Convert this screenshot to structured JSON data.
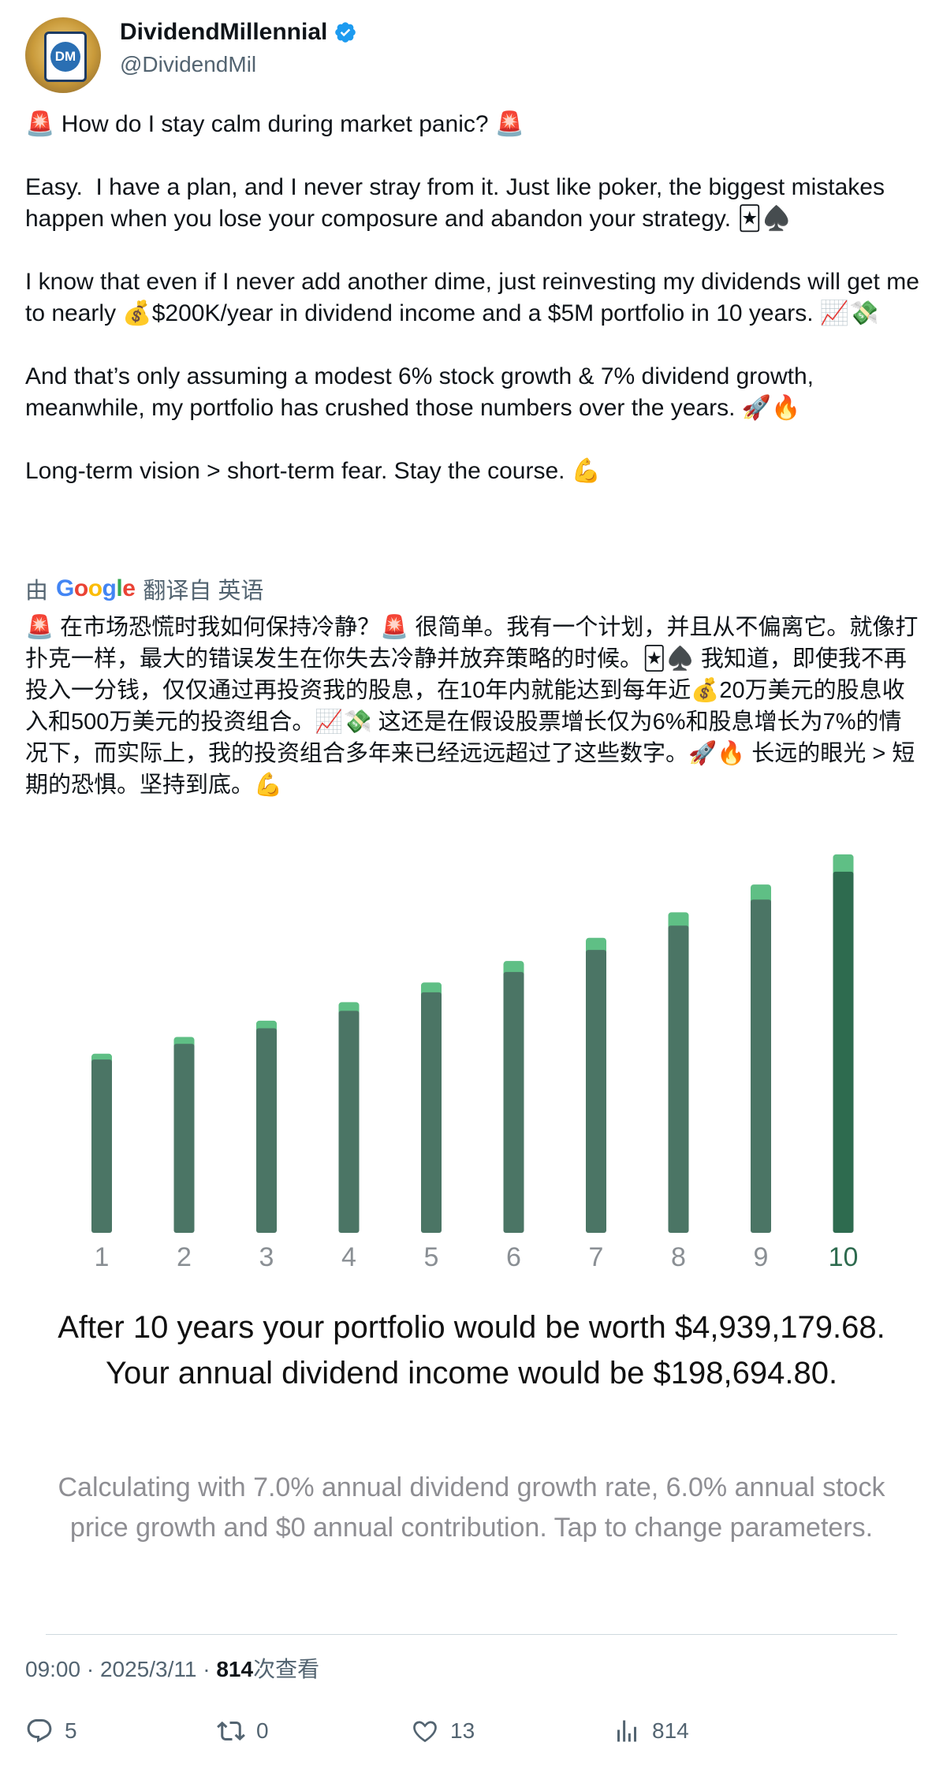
{
  "author": {
    "display_name": "DividendMillennial",
    "handle": "@DividendMil",
    "avatar_text": "DM",
    "verified": true
  },
  "tweet": {
    "paragraphs": [
      "🚨 How do I stay calm during market panic? 🚨",
      "Easy.  I have a plan, and I never stray from it. Just like poker, the biggest mistakes happen when you lose your composure and abandon your strategy. 🃏♠️",
      "I know that even if I never add another dime, just reinvesting my dividends will get me to nearly 💰$200K/year in dividend income and a $5M portfolio in 10 years. 📈💸",
      "And that’s only assuming a modest 6% stock growth & 7% dividend growth, meanwhile, my portfolio has crushed those numbers over the years. 🚀🔥",
      "Long-term vision > short-term fear. Stay the course. 💪"
    ]
  },
  "translation": {
    "prefix": "由",
    "google": "Google",
    "suffix": "翻译自 英语",
    "text": "🚨 在市场恐慌时我如何保持冷静？🚨 很简单。我有一个计划，并且从不偏离它。就像打扑克一样，最大的错误发生在你失去冷静并放弃策略的时候。🃏♠️ 我知道，即使我不再投入一分钱，仅仅通过再投资我的股息，在10年内就能达到每年近💰20万美元的股息收入和500万美元的投资组合。📈💸 这还是在假设股票增长仅为6%和股息增长为7%的情况下，而实际上，我的投资组合多年来已经远远超过了这些数字。🚀🔥 长远的眼光 > 短期的恐惧。坚持到底。💪"
  },
  "chart_data": {
    "type": "bar",
    "categories": [
      "1",
      "2",
      "3",
      "4",
      "5",
      "6",
      "7",
      "8",
      "9",
      "10"
    ],
    "highlighted_category": "10",
    "series": [
      {
        "values": [
          2.99,
          3.26,
          3.53,
          3.83,
          4.15,
          4.5,
          4.88,
          5.3,
          5.75,
          6.23
        ]
      },
      {
        "values": [
          0.1,
          0.12,
          0.13,
          0.15,
          0.17,
          0.19,
          0.21,
          0.23,
          0.26,
          0.3
        ]
      }
    ],
    "stacked": true,
    "ylim": [
      0,
      6.8
    ],
    "grid": false,
    "title": "",
    "xlabel": "",
    "ylabel": "",
    "colors": {
      "base": "#4b7565",
      "base_highlight": "#2e6b4f",
      "top": "#5fbf85",
      "tick": "#8a8f94",
      "tick_highlight": "#2e6b4f"
    }
  },
  "summary": "After 10 years your portfolio would be worth $4,939,179.68. Your annual dividend income would be $198,694.80.",
  "parameters_note": "Calculating with 7.0% annual dividend growth rate, 6.0% annual stock price growth and $0 annual contribution. Tap to change parameters.",
  "meta": {
    "time": "09:00",
    "date": "2025/3/11",
    "views": "814",
    "views_label": "次查看"
  },
  "actions": {
    "replies": "5",
    "retweets": "0",
    "likes": "13",
    "views": "814"
  }
}
